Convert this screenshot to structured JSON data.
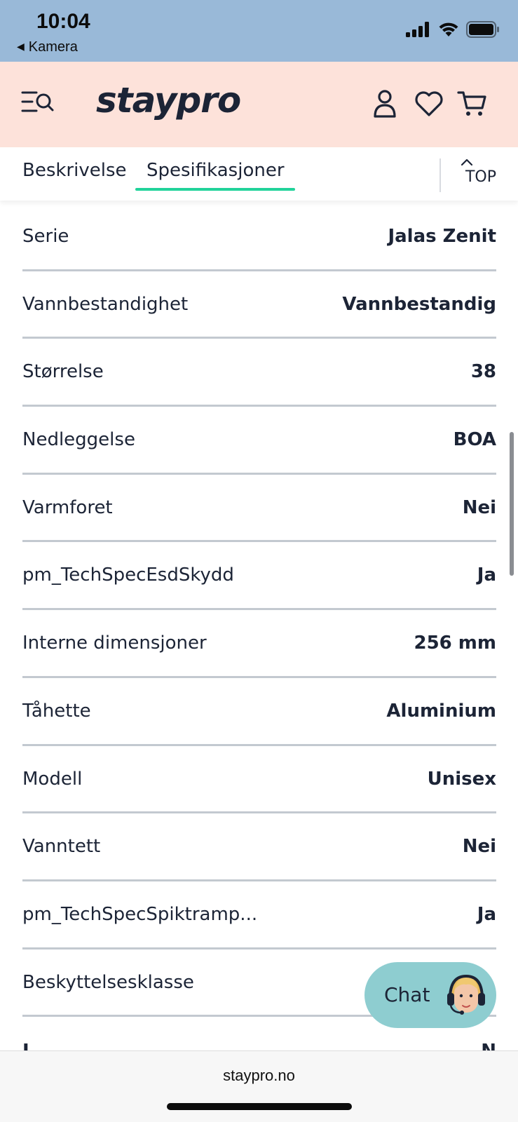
{
  "status_bar": {
    "time": "10:04",
    "back_label": "Kamera",
    "icons": [
      "cellular-signal-icon",
      "wifi-icon",
      "battery-icon"
    ]
  },
  "header": {
    "logo": "staypro",
    "icons": [
      "menu-search-icon",
      "account-icon",
      "heart-icon",
      "cart-icon"
    ]
  },
  "tabs": {
    "items": [
      {
        "label": "Beskrivelse",
        "active": false
      },
      {
        "label": "Spesifikasjoner",
        "active": true
      }
    ],
    "top_label": "TOP",
    "accent_color": "#21d39a"
  },
  "specs": [
    {
      "label": "Serie",
      "value": "Jalas Zenit"
    },
    {
      "label": "Vannbestandighet",
      "value": "Vannbestandig"
    },
    {
      "label": "Størrelse",
      "value": "38"
    },
    {
      "label": "Nedleggelse",
      "value": "BOA"
    },
    {
      "label": "Varmforet",
      "value": "Nei"
    },
    {
      "label": "pm_TechSpecEsdSkydd",
      "value": "Ja"
    },
    {
      "label": "Interne dimensjoner",
      "value": "256 mm"
    },
    {
      "label": "Tåhette",
      "value": "Aluminium"
    },
    {
      "label": "Modell",
      "value": "Unisex"
    },
    {
      "label": "Vanntett",
      "value": "Nei"
    },
    {
      "label": "pm_TechSpecSpiktramp...",
      "value": "Ja"
    },
    {
      "label": "Beskyttelsesklasse",
      "value": ""
    }
  ],
  "chat": {
    "label": "Chat",
    "color": "#8ecdd0"
  },
  "browser": {
    "url": "staypro.no"
  },
  "colors": {
    "status_bar_bg": "#99b9d8",
    "header_bg": "#fde2da",
    "text": "#1c2436"
  }
}
